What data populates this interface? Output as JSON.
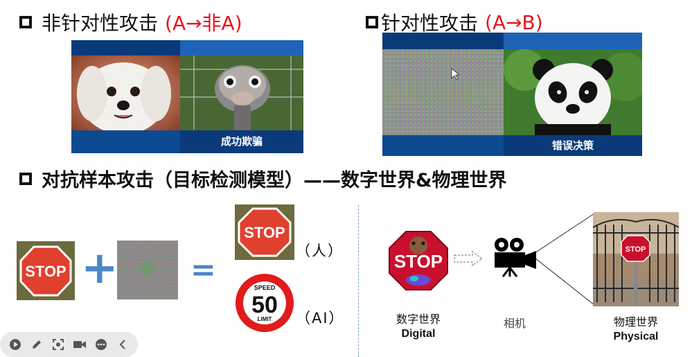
{
  "section1": {
    "title": "非针对性攻击",
    "tag": "(A→非A)",
    "caption": "成功欺骗"
  },
  "section2": {
    "title": "针对性攻击",
    "tag": "(A→B)",
    "caption": "错误决策"
  },
  "section3": {
    "title": "对抗样本攻击（目标检测模型）——数字世界&物理世界"
  },
  "equation": {
    "plus": "+",
    "equals": "=",
    "stop_text": "STOP",
    "human_label": "（人）",
    "ai_label": "（AI）",
    "speed_top": "SPEED",
    "speed_value": "50",
    "speed_bottom": "LIMIT"
  },
  "digital_world": {
    "label_cn": "数字世界",
    "label_en": "Digital",
    "stop_text": "STOP"
  },
  "camera": {
    "label": "相机"
  },
  "physical_world": {
    "label_cn": "物理世界",
    "label_en": "Physical",
    "stop_text": "STOP"
  },
  "toolbar": {
    "items": [
      "play-icon",
      "pen-icon",
      "screenshot-icon",
      "camera-icon",
      "more-icon",
      "collapse-icon"
    ]
  },
  "colors": {
    "accent_red": "#e8141a",
    "panel_blue": "#0a3a7a",
    "plus_blue": "#4a86c6"
  }
}
